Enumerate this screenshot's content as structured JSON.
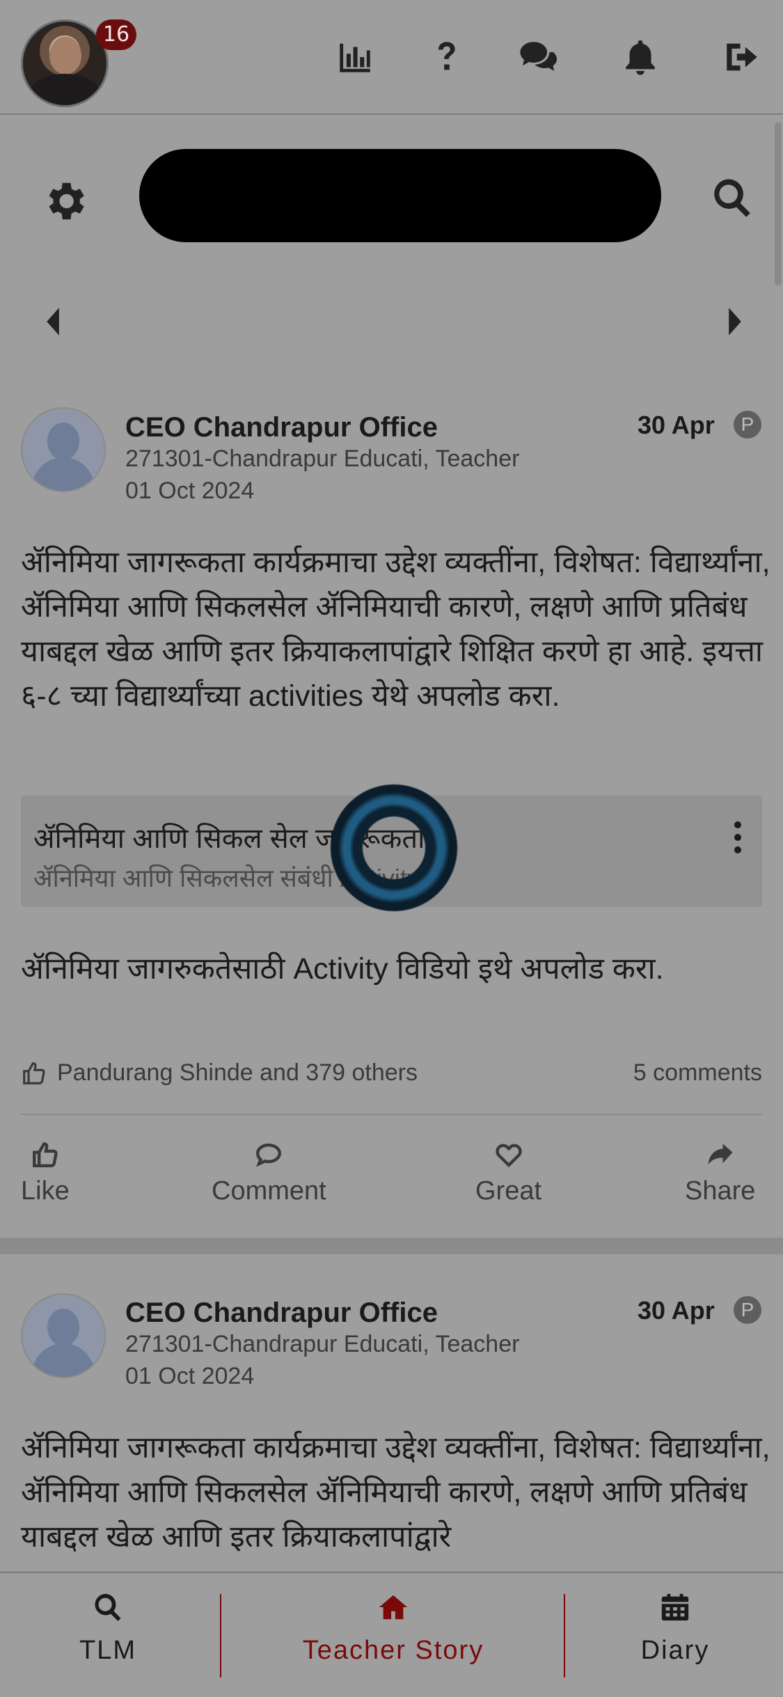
{
  "header": {
    "notification_count": "16",
    "icons": [
      "bar-chart-icon",
      "help-icon",
      "chat-icon",
      "bell-icon",
      "logout-icon"
    ]
  },
  "search": {
    "settings_icon": "gear-icon",
    "search_icon": "search-icon"
  },
  "posts": [
    {
      "author": "CEO Chandrapur Office",
      "subtitle": "271301-Chandrapur Educati, Teacher",
      "posted": "01 Oct 2024",
      "date": "30 Apr",
      "badge": "P",
      "body": "ॲनिमिया जागरूकता कार्यक्रमाचा उद्देश व्यक्तींना, विशेषत: विद्यार्थ्यांना, ॲनिमिया आणि सिकलसेल ॲनिमियाची कारणे, लक्षणे आणि प्रतिबंध याबद्दल खेळ आणि इतर क्रियाकलापांद्वारे शिक्षित करणे हा आहे. इयत्ता ६-८ च्या विद्यार्थ्यांच्या activities येथे अपलोड करा.",
      "attachment": {
        "title": "ॲनिमिया आणि सिकल सेल जागरूकता",
        "subtitle": "ॲनिमिया आणि सिकलसेल संबंधी Activity"
      },
      "activity_note": "ॲनिमिया जागरुकतेसाठी Activity विडियो इथे अपलोड करा.",
      "likes_text": "Pandurang Shinde and 379 others",
      "comments_text": "5 comments",
      "actions": [
        "Like",
        "Comment",
        "Great",
        "Share"
      ]
    },
    {
      "author": "CEO Chandrapur Office",
      "subtitle": "271301-Chandrapur Educati, Teacher",
      "posted": "01 Oct 2024",
      "date": "30 Apr",
      "badge": "P",
      "body": "ॲनिमिया जागरूकता कार्यक्रमाचा उद्देश व्यक्तींना, विशेषत: विद्यार्थ्यांना, ॲनिमिया आणि सिकलसेल ॲनिमियाची कारणे, लक्षणे आणि प्रतिबंध याबद्दल खेळ आणि इतर क्रियाकलापांद्वारे"
    }
  ],
  "bottom_nav": [
    {
      "label": "TLM",
      "icon": "search-icon",
      "active": false
    },
    {
      "label": "Teacher Story",
      "icon": "home-icon",
      "active": true
    },
    {
      "label": "Diary",
      "icon": "calendar-icon",
      "active": false
    }
  ],
  "colors": {
    "accent": "#7a0a0a",
    "overlay": "#9e9e9e",
    "badge": "#6b0d0d"
  }
}
